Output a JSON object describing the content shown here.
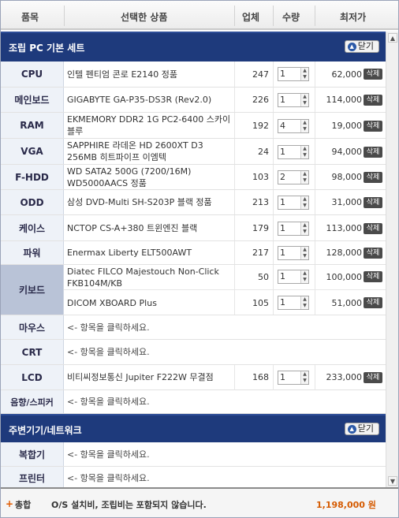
{
  "header": {
    "col_category": "품목",
    "col_product": "선택한 상품",
    "col_vendor": "업체",
    "col_qty": "수량",
    "col_price": "최저가"
  },
  "section1": {
    "title": "조립 PC 기본 세트",
    "fold_label": "닫기"
  },
  "section2": {
    "title": "주변기기/네트워크",
    "fold_label": "닫기"
  },
  "delete_label": "삭제",
  "rows": [
    {
      "category": "CPU",
      "product": "인텔 펜티엄 콘로 E2140 정품",
      "vendors": "247",
      "qty": "1",
      "price": "62,000"
    },
    {
      "category": "메인보드",
      "product": "GIGABYTE GA-P35-DS3R (Rev2.0)",
      "vendors": "226",
      "qty": "1",
      "price": "114,000"
    },
    {
      "category": "RAM",
      "product": "EKMEMORY DDR2 1G PC2-6400 스카이블루",
      "vendors": "192",
      "qty": "4",
      "price": "19,000"
    },
    {
      "category": "VGA",
      "product": "SAPPHIRE 라데온 HD 2600XT D3 256MB 히트파이프 이엠텍",
      "vendors": "24",
      "qty": "1",
      "price": "94,000"
    },
    {
      "category": "F-HDD",
      "product": "WD SATA2 500G (7200/16M) WD5000AACS 정품",
      "vendors": "103",
      "qty": "2",
      "price": "98,000"
    },
    {
      "category": "ODD",
      "product": "삼성 DVD-Multi SH-S203P 블랙 정품",
      "vendors": "213",
      "qty": "1",
      "price": "31,000"
    },
    {
      "category": "케이스",
      "product": "NCTOP CS-A+380 트윈엔진 블랙",
      "vendors": "179",
      "qty": "1",
      "price": "113,000"
    },
    {
      "category": "파워",
      "product": "Enermax Liberty ELT500AWT",
      "vendors": "217",
      "qty": "1",
      "price": "128,000"
    },
    {
      "category": "키보드",
      "product": "Diatec FILCO Majestouch Non-Click FKB104M/KB",
      "vendors": "50",
      "qty": "1",
      "price": "100,000"
    },
    {
      "category": "",
      "product": "DICOM XBOARD Plus",
      "vendors": "105",
      "qty": "1",
      "price": "51,000"
    },
    {
      "category": "마우스",
      "product": "<- 항목을 클릭하세요."
    },
    {
      "category": "CRT",
      "product": "<- 항목을 클릭하세요."
    },
    {
      "category": "LCD",
      "product": "비티씨정보통신 Jupiter F222W 무결점",
      "vendors": "168",
      "qty": "1",
      "price": "233,000"
    },
    {
      "category": "음향/스피커",
      "product": "<- 항목을 클릭하세요."
    }
  ],
  "rows2": [
    {
      "category": "복합기",
      "product": "<- 항목을 클릭하세요."
    },
    {
      "category": "프린터",
      "product": "<- 항목을 클릭하세요."
    }
  ],
  "footer": {
    "label": "총합",
    "note": "O/S 설치비, 조립비는 포함되지 않습니다.",
    "total": "1,198,000 원"
  }
}
